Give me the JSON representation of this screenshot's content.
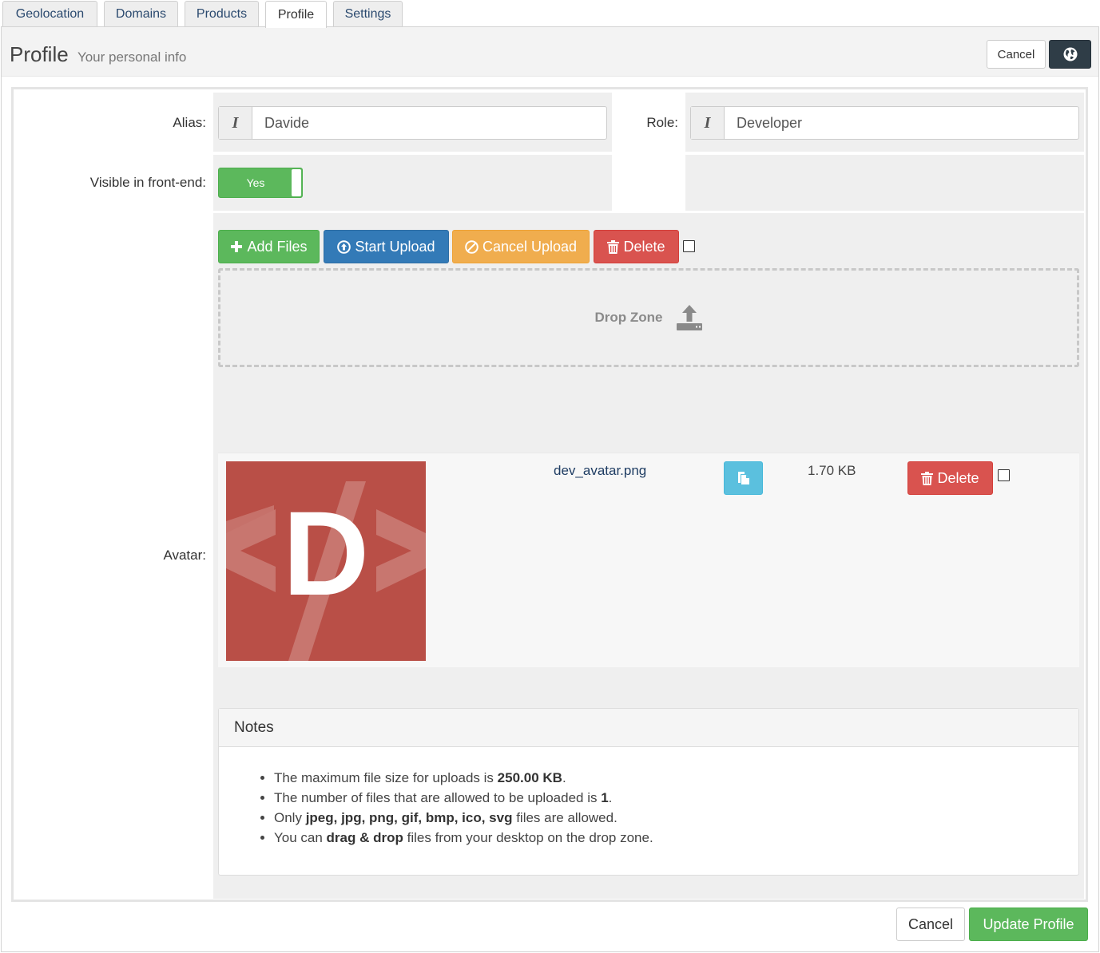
{
  "tabs": [
    {
      "label": "Geolocation",
      "active": false
    },
    {
      "label": "Domains",
      "active": false
    },
    {
      "label": "Products",
      "active": false
    },
    {
      "label": "Profile",
      "active": true
    },
    {
      "label": "Settings",
      "active": false
    }
  ],
  "header": {
    "title": "Profile",
    "subtitle": "Your personal info",
    "cancel_label": "Cancel",
    "globe_icon": "globe-icon"
  },
  "form": {
    "alias": {
      "label": "Alias:",
      "value": "Davide",
      "addon": "I"
    },
    "role": {
      "label": "Role:",
      "value": "Developer",
      "addon": "I"
    },
    "visible": {
      "label": "Visible in front-end:",
      "value": "Yes"
    },
    "avatar": {
      "label": "Avatar:"
    }
  },
  "upload": {
    "add_files": "Add Files",
    "start_upload": "Start Upload",
    "cancel_upload": "Cancel Upload",
    "delete": "Delete",
    "drop_zone": "Drop Zone"
  },
  "file": {
    "name": "dev_avatar.png",
    "size": "1.70 KB",
    "delete": "Delete",
    "avatar_letter": "D"
  },
  "notes": {
    "title": "Notes",
    "items": [
      {
        "pre": "The maximum file size for uploads is ",
        "bold": "250.00 KB",
        "post": "."
      },
      {
        "pre": "The number of files that are allowed to be uploaded is ",
        "bold": "1",
        "post": "."
      },
      {
        "pre": "Only ",
        "bold": "jpeg, jpg, png, gif, bmp, ico, svg",
        "post": " files are allowed."
      },
      {
        "pre": "You can ",
        "bold": "drag & drop",
        "post": " files from your desktop on the drop zone."
      }
    ]
  },
  "footer": {
    "cancel_label": "Cancel",
    "update_label": "Update Profile"
  },
  "colors": {
    "success": "#5cb85c",
    "primary": "#337ab7",
    "warning": "#f0ad4e",
    "danger": "#d9534f",
    "info": "#5bc0de",
    "avatar_bg": "#b94f47"
  }
}
